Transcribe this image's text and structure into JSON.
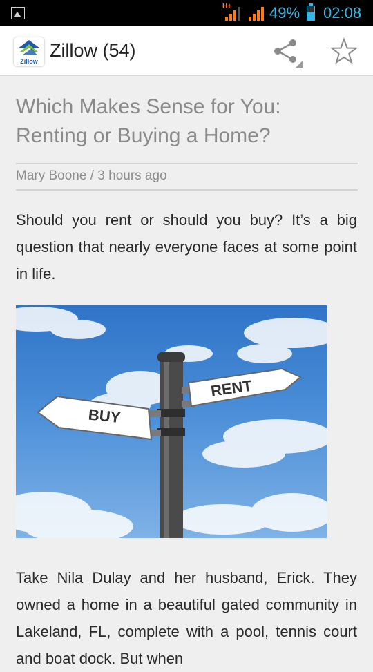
{
  "status_bar": {
    "network_type": "H+",
    "battery_percent": "49%",
    "time": "02:08",
    "accent_color": "#33b5e5",
    "signal_color": "#ff7a1a"
  },
  "action_bar": {
    "logo_text": "Zillow",
    "title": "Zillow (54)",
    "icons": [
      "share-icon",
      "star-icon"
    ]
  },
  "article": {
    "title": "Which Makes Sense for You: Renting or Buying a Home?",
    "byline": "Mary Boone / 3 hours ago",
    "intro": "Should you rent or should you buy? It’s a big question that nearly everyone faces at some point in life.",
    "image": {
      "sign_left": "BUY",
      "sign_right": "RENT"
    },
    "body": "Take Nila Dulay and her husband, Erick. They owned a home in a beautiful gated community in Lakeland, FL, complete with a pool, tennis court and boat dock. But when"
  }
}
